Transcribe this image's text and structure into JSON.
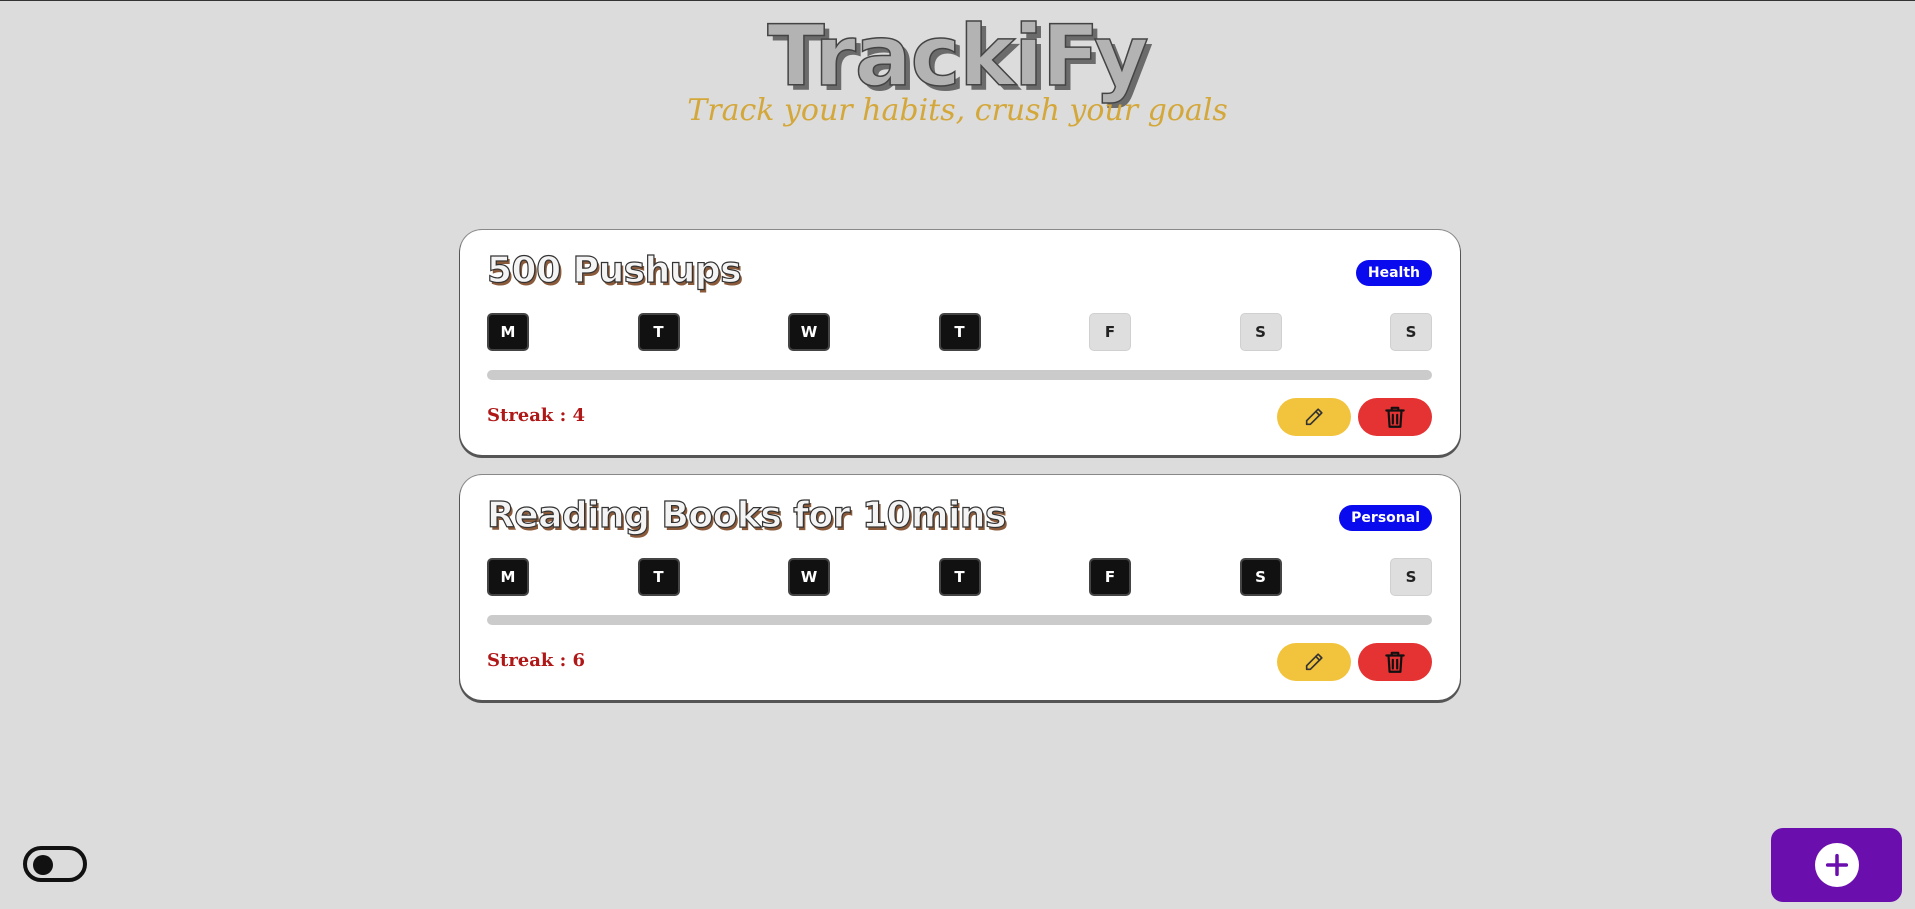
{
  "app": {
    "title": "TrackiFy",
    "tagline": "Track your habits, crush your goals"
  },
  "colors": {
    "background": "#dcdcdc",
    "tag_badge": "#0a0aee",
    "edit_button": "#f2c33c",
    "delete_button": "#e53232",
    "streak_text": "#b01818",
    "fab": "#6a0fae",
    "day_done": "#111111",
    "day_todo": "#dedede"
  },
  "habits": [
    {
      "name": "500 Pushups",
      "category": "Health",
      "days": [
        {
          "label": "M",
          "done": true
        },
        {
          "label": "T",
          "done": true
        },
        {
          "label": "W",
          "done": true
        },
        {
          "label": "T",
          "done": true
        },
        {
          "label": "F",
          "done": false
        },
        {
          "label": "S",
          "done": false
        },
        {
          "label": "S",
          "done": false
        }
      ],
      "progress": 0,
      "streak_label": "Streak : 4",
      "edit_icon": "pencil-icon",
      "delete_icon": "trash-icon"
    },
    {
      "name": "Reading Books for 10mins",
      "category": "Personal",
      "days": [
        {
          "label": "M",
          "done": true
        },
        {
          "label": "T",
          "done": true
        },
        {
          "label": "W",
          "done": true
        },
        {
          "label": "T",
          "done": true
        },
        {
          "label": "F",
          "done": true
        },
        {
          "label": "S",
          "done": true
        },
        {
          "label": "S",
          "done": false
        }
      ],
      "progress": 0,
      "streak_label": "Streak : 6",
      "edit_icon": "pencil-icon",
      "delete_icon": "trash-icon"
    }
  ],
  "theme_toggle": {
    "state": "off"
  },
  "fab": {
    "icon": "plus-icon"
  }
}
